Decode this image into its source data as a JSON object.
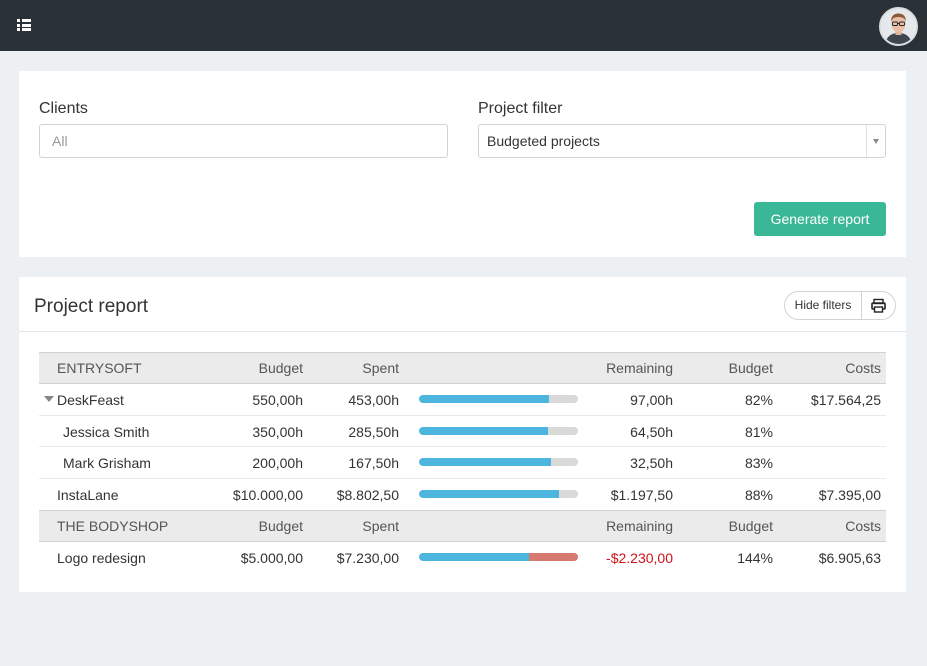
{
  "filters": {
    "clients_label": "Clients",
    "clients_placeholder": "All",
    "project_filter_label": "Project filter",
    "project_filter_value": "Budgeted projects",
    "generate_label": "Generate report"
  },
  "report": {
    "title": "Project report",
    "hide_filters_label": "Hide filters"
  },
  "groups": [
    {
      "client": "ENTRYSOFT",
      "headers": {
        "budget": "Budget",
        "spent": "Spent",
        "remaining": "Remaining",
        "budget_pct": "Budget",
        "costs": "Costs"
      },
      "rows": [
        {
          "name": "DeskFeast",
          "budget": "550,00h",
          "spent": "453,00h",
          "progress": 0.82,
          "remaining": "97,00h",
          "budget_pct": "82%",
          "costs": "$17.564,25",
          "expanded": true
        },
        {
          "name": "Jessica Smith",
          "budget": "350,00h",
          "spent": "285,50h",
          "progress": 0.81,
          "remaining": "64,50h",
          "budget_pct": "81%",
          "costs": ""
        },
        {
          "name": "Mark Grisham",
          "budget": "200,00h",
          "spent": "167,50h",
          "progress": 0.83,
          "remaining": "32,50h",
          "budget_pct": "83%",
          "costs": ""
        },
        {
          "name": "InstaLane",
          "budget": "$10.000,00",
          "spent": "$8.802,50",
          "progress": 0.88,
          "remaining": "$1.197,50",
          "budget_pct": "88%",
          "costs": "$7.395,00"
        }
      ]
    },
    {
      "client": "THE BODYSHOP",
      "headers": {
        "budget": "Budget",
        "spent": "Spent",
        "remaining": "Remaining",
        "budget_pct": "Budget",
        "costs": "Costs"
      },
      "rows": [
        {
          "name": "Logo redesign",
          "budget": "$5.000,00",
          "spent": "$7.230,00",
          "progress": 1.44,
          "remaining": "-$2.230,00",
          "budget_pct": "144%",
          "costs": "$6.905,63"
        }
      ]
    }
  ],
  "colors": {
    "accent": "#3ab796",
    "bar": "#4cb6df",
    "over_budget": "#d6796e",
    "negative": "#d0111a"
  },
  "icons": {
    "menu": "list-icon",
    "print": "print-icon",
    "expand": "caret-down-icon"
  }
}
